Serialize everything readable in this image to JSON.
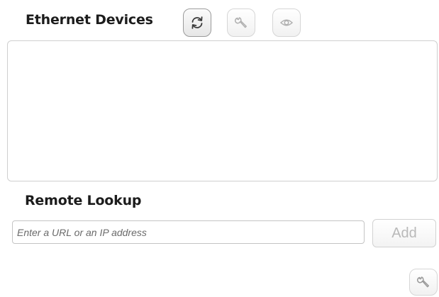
{
  "ethernet": {
    "title": "Ethernet Devices",
    "devices": [],
    "toolbar": {
      "refresh_icon": "refresh-icon",
      "config_icon": "wrench-icon",
      "view_icon": "eye-icon"
    }
  },
  "remote": {
    "title": "Remote Lookup",
    "input_placeholder": "Enter a URL or an IP address",
    "input_value": "",
    "add_label": "Add"
  },
  "footer": {
    "config_icon": "wrench-icon"
  },
  "colors": {
    "border": "#cfcfcf",
    "disabled_text": "#b9b9b9",
    "title_text": "#1c1c1c",
    "icon_active": "#3a3a3a",
    "icon_disabled": "#b0b0b0"
  }
}
